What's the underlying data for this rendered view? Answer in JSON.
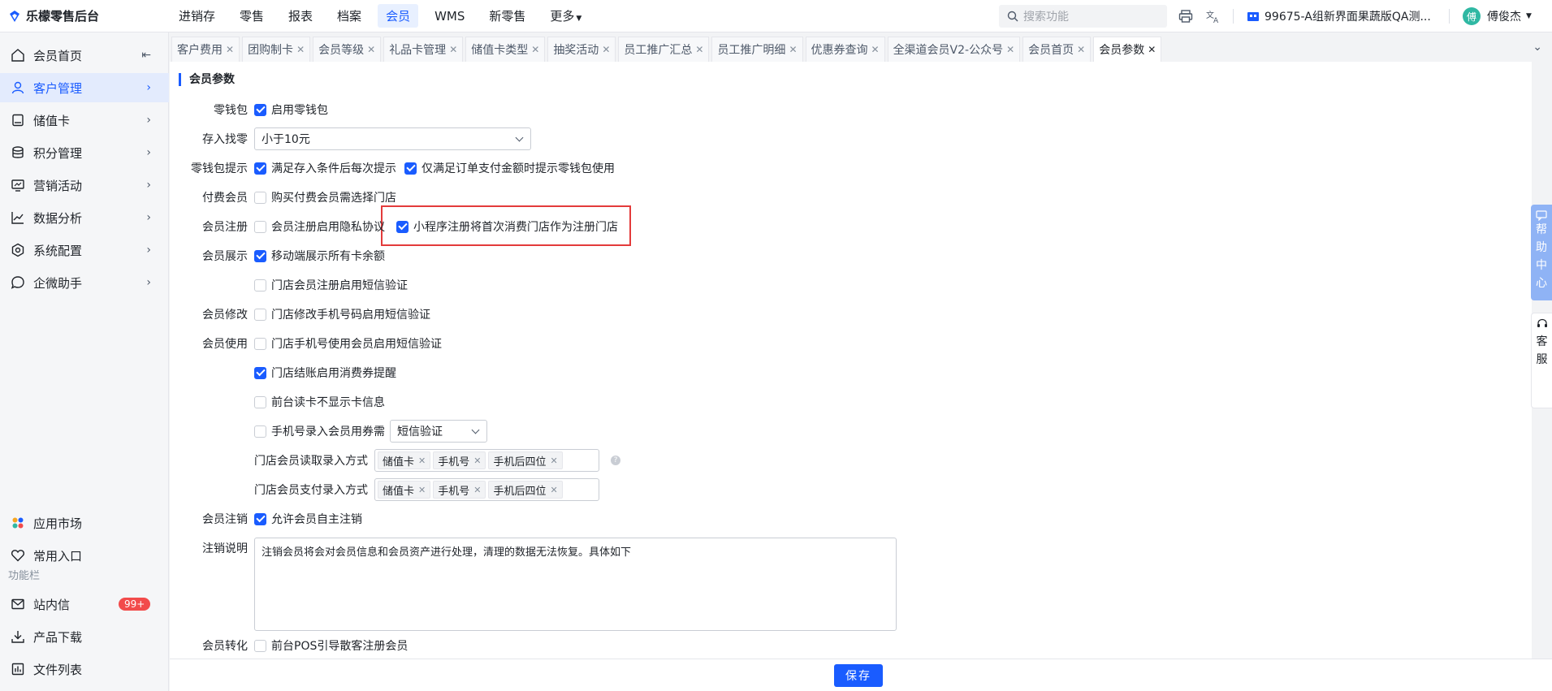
{
  "app": {
    "title": "乐檬零售后台"
  },
  "topnav": {
    "items": [
      {
        "label": "进销存",
        "active": false
      },
      {
        "label": "零售",
        "active": false
      },
      {
        "label": "报表",
        "active": false
      },
      {
        "label": "档案",
        "active": false
      },
      {
        "label": "会员",
        "active": true
      },
      {
        "label": "WMS",
        "active": false
      },
      {
        "label": "新零售",
        "active": false
      },
      {
        "label": "更多",
        "active": false
      }
    ],
    "search_placeholder": "搜索功能",
    "store": "99675-A组新界面果蔬版QA测...",
    "user_avatar": "傅",
    "user_name": "傅俊杰"
  },
  "sidebar": {
    "items": [
      {
        "label": "会员首页",
        "icon": "home-icon"
      },
      {
        "label": "客户管理",
        "icon": "user-icon"
      },
      {
        "label": "储值卡",
        "icon": "card-icon"
      },
      {
        "label": "积分管理",
        "icon": "database-icon"
      },
      {
        "label": "营销活动",
        "icon": "monitor-icon"
      },
      {
        "label": "数据分析",
        "icon": "line-chart-icon"
      },
      {
        "label": "系统配置",
        "icon": "settings-icon"
      },
      {
        "label": "企微助手",
        "icon": "chat-icon"
      }
    ],
    "bottom_items": [
      {
        "label": "应用市场",
        "icon": "app-market-icon"
      },
      {
        "label": "常用入口",
        "icon": "heart-icon"
      }
    ],
    "section_label": "功能栏",
    "function_items": [
      {
        "label": "站内信",
        "icon": "mail-icon",
        "badge": "99+"
      },
      {
        "label": "产品下载",
        "icon": "download-icon"
      },
      {
        "label": "文件列表",
        "icon": "file-list-icon"
      }
    ]
  },
  "tabs": [
    {
      "label": "客户费用",
      "active": false
    },
    {
      "label": "团购制卡",
      "active": false
    },
    {
      "label": "会员等级",
      "active": false
    },
    {
      "label": "礼品卡管理",
      "active": false
    },
    {
      "label": "储值卡类型",
      "active": false
    },
    {
      "label": "抽奖活动",
      "active": false
    },
    {
      "label": "员工推广汇总",
      "active": false
    },
    {
      "label": "员工推广明细",
      "active": false
    },
    {
      "label": "优惠券查询",
      "active": false
    },
    {
      "label": "全渠道会员V2-公众号",
      "active": false
    },
    {
      "label": "会员首页",
      "active": false
    },
    {
      "label": "会员参数",
      "active": true
    }
  ],
  "form": {
    "section_title": "会员参数",
    "wallet": {
      "label": "零钱包",
      "option": "启用零钱包",
      "checked": true
    },
    "deposit_change": {
      "label": "存入找零",
      "value": "小于10元"
    },
    "wallet_tip": {
      "label": "零钱包提示",
      "option1": "满足存入条件后每次提示",
      "option1_checked": true,
      "option2": "仅满足订单支付金额时提示零钱包使用",
      "option2_checked": true
    },
    "paid_member": {
      "label": "付费会员",
      "option": "购买付费会员需选择门店",
      "checked": false
    },
    "member_register": {
      "label": "会员注册",
      "option1": "会员注册启用隐私协议",
      "option1_checked": false,
      "option2": "小程序注册将首次消费门店作为注册门店",
      "option2_checked": true
    },
    "member_display": {
      "label": "会员展示",
      "option1": "移动端展示所有卡余额",
      "option1_checked": true,
      "option2": "门店会员注册启用短信验证",
      "option2_checked": false
    },
    "member_modify": {
      "label": "会员修改",
      "option": "门店修改手机号码启用短信验证",
      "checked": false
    },
    "member_use": {
      "label": "会员使用",
      "option1": "门店手机号使用会员启用短信验证",
      "option1_checked": false,
      "option2": "门店结账启用消费券提醒",
      "option2_checked": true,
      "option3": "前台读卡不显示卡信息",
      "option3_checked": false,
      "option4": "手机号录入会员用券需",
      "option4_checked": false,
      "option4_select": "短信验证",
      "read_mode_label": "门店会员读取录入方式",
      "read_mode_tags": [
        "储值卡",
        "手机号",
        "手机后四位"
      ],
      "pay_mode_label": "门店会员支付录入方式",
      "pay_mode_tags": [
        "储值卡",
        "手机号",
        "手机后四位"
      ]
    },
    "member_cancel": {
      "label": "会员注销",
      "option": "允许会员自主注销",
      "checked": true
    },
    "cancel_note": {
      "label": "注销说明",
      "value": "注销会员将会对会员信息和会员资产进行处理，清理的数据无法恢复。具体如下"
    },
    "member_convert": {
      "label": "会员转化",
      "option": "前台POS引导散客注册会员",
      "checked": false
    }
  },
  "actions": {
    "save": "保存"
  },
  "float": {
    "help": [
      "帮",
      "助",
      "中",
      "心"
    ],
    "service": [
      "客",
      "服"
    ]
  },
  "colors": {
    "accent": "#1a5cff",
    "highlight": "#e33b3b",
    "badge": "#f24b4b"
  }
}
